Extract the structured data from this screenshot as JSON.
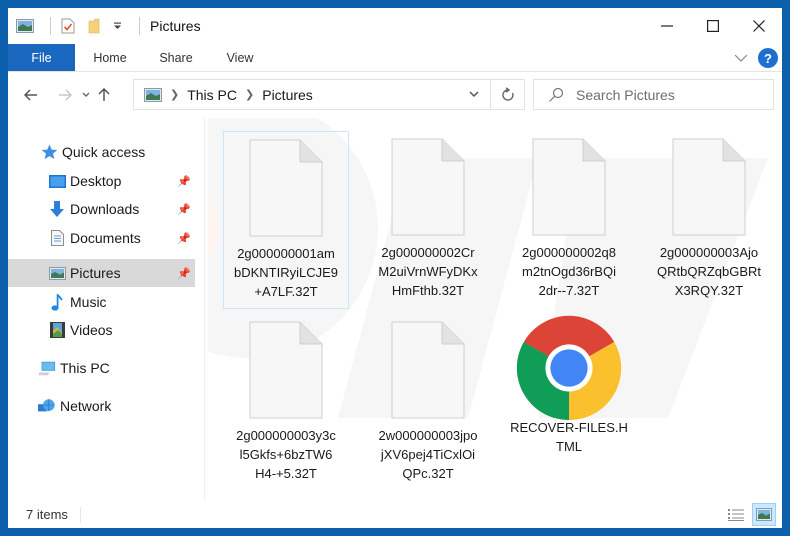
{
  "window": {
    "title": "Pictures",
    "controls": {
      "minimize": "minimize",
      "maximize": "maximize",
      "close": "close"
    }
  },
  "ribbon": {
    "tabs": [
      {
        "label": "File",
        "active": true
      },
      {
        "label": "Home"
      },
      {
        "label": "Share"
      },
      {
        "label": "View"
      }
    ],
    "help_label": "?"
  },
  "navigation": {
    "breadcrumb": [
      "This PC",
      "Pictures"
    ],
    "search_placeholder": "Search Pictures"
  },
  "sidebar": {
    "items": [
      {
        "label": "Quick access",
        "icon": "star-icon",
        "level": 0
      },
      {
        "label": "Desktop",
        "icon": "desktop-icon",
        "level": 1,
        "pinned": true
      },
      {
        "label": "Downloads",
        "icon": "download-arrow-icon",
        "level": 1,
        "pinned": true
      },
      {
        "label": "Documents",
        "icon": "document-icon",
        "level": 1,
        "pinned": true
      },
      {
        "label": "Pictures",
        "icon": "pictures-icon",
        "level": 1,
        "pinned": true,
        "selected": true
      },
      {
        "label": "Music",
        "icon": "music-note-icon",
        "level": 1
      },
      {
        "label": "Videos",
        "icon": "film-icon",
        "level": 1
      },
      {
        "label": "This PC",
        "icon": "computer-icon",
        "level": 0
      },
      {
        "label": "Network",
        "icon": "network-icon",
        "level": 0
      }
    ]
  },
  "files": [
    {
      "name_lines": [
        "2g000000001am",
        "bDKNTIRyiLCJE9",
        "+A7LF.32T"
      ],
      "type": "generic-file",
      "focused": true
    },
    {
      "name_lines": [
        "2g000000002Cr",
        "M2uiVrnWFyDKx",
        "HmFthb.32T"
      ],
      "type": "generic-file"
    },
    {
      "name_lines": [
        "2g000000002q8",
        "m2tnOgd36rBQi",
        "2dr--7.32T"
      ],
      "type": "generic-file"
    },
    {
      "name_lines": [
        "2g000000003Ajo",
        "QRtbQRZqbGBRt",
        "X3RQY.32T"
      ],
      "type": "generic-file"
    },
    {
      "name_lines": [
        "2g000000003y3c",
        "l5Gkfs+6bzTW6",
        "H4-+5.32T"
      ],
      "type": "generic-file"
    },
    {
      "name_lines": [
        "2w000000003jpo",
        "jXV6pej4TiCxlOi",
        "QPc.32T"
      ],
      "type": "generic-file"
    },
    {
      "name_lines": [
        "RECOVER-FILES.H",
        "TML"
      ],
      "type": "chrome-html"
    }
  ],
  "status": {
    "item_count": "7 items"
  },
  "colors": {
    "frame": "#0c5fab",
    "file_tab": "#1967be",
    "selected_nav": "#d9d9d9",
    "accent": "#1f6fcf"
  }
}
